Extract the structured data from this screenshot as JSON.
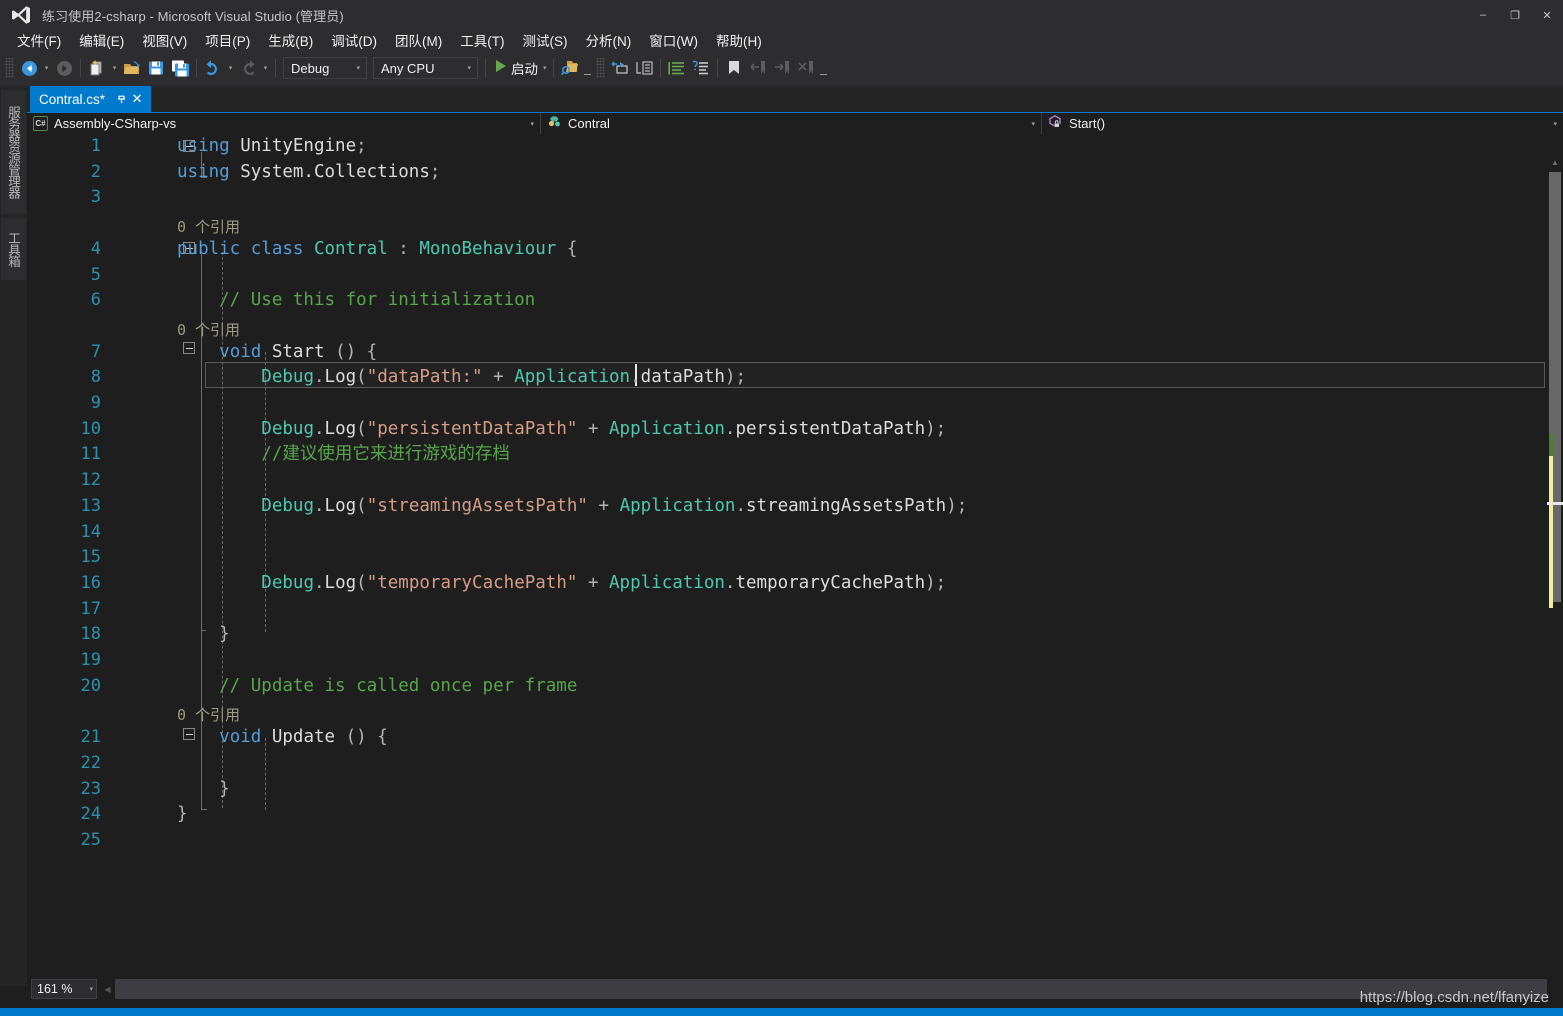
{
  "window": {
    "title": "练习使用2-csharp - Microsoft Visual Studio (管理员)",
    "logo_icon": "visual-studio-logo",
    "minimize_label": "–",
    "maximize_label": "❐",
    "close_label": "✕",
    "accent_color": "#007acc",
    "chrome_color": "#2d2d30"
  },
  "menu": {
    "items": [
      {
        "label": "文件(F)"
      },
      {
        "label": "编辑(E)"
      },
      {
        "label": "视图(V)"
      },
      {
        "label": "项目(P)"
      },
      {
        "label": "生成(B)"
      },
      {
        "label": "调试(D)"
      },
      {
        "label": "团队(M)"
      },
      {
        "label": "工具(T)"
      },
      {
        "label": "测试(S)"
      },
      {
        "label": "分析(N)"
      },
      {
        "label": "窗口(W)"
      },
      {
        "label": "帮助(H)"
      }
    ]
  },
  "toolbar": {
    "navigate_back_icon": "navigate-back-icon",
    "navigate_forward_icon": "navigate-forward-icon",
    "new_item_icon": "new-item-icon",
    "open_file_icon": "open-file-icon",
    "save_icon": "save-icon",
    "save_all_icon": "save-all-icon",
    "undo_icon": "undo-icon",
    "redo_icon": "redo-icon",
    "configuration": {
      "value": "Debug",
      "arrow": "▾"
    },
    "platform": {
      "value": "Any CPU",
      "arrow": "▾"
    },
    "run_label": "启动",
    "run_icon": "play-icon",
    "run_arrow": "▾",
    "find_icon": "find-in-files-icon",
    "step_icon": "step-into-icon",
    "call_stack_icon": "call-hierarchy-icon",
    "comment_icon": "comment-selection-icon",
    "uncomment_icon": "uncomment-selection-icon",
    "indent_icon": "increase-indent-icon",
    "outdent_icon": "decrease-indent-icon",
    "bookmark_icon": "bookmark-icon",
    "prev_bookmark_icon": "previous-bookmark-icon",
    "next_bookmark_icon": "next-bookmark-icon",
    "clear_bookmark_icon": "clear-bookmarks-icon",
    "overflow_icon": "toolbar-overflow-icon"
  },
  "left_rail": {
    "tabs": [
      {
        "label": "服务器资源管理器",
        "name": "server-explorer"
      },
      {
        "label": "工具箱",
        "name": "toolbox"
      }
    ]
  },
  "document_tab": {
    "label": "Contral.cs*",
    "pin_icon": "pin-icon",
    "close_icon": "close-icon"
  },
  "navbar": {
    "project": {
      "label": "Assembly-CSharp-vs",
      "icon": "csharp-project-icon",
      "arrow": "▾"
    },
    "type": {
      "label": "Contral",
      "icon": "class-icon",
      "arrow": "▾"
    },
    "member": {
      "label": "Start()",
      "icon": "method-private-icon",
      "arrow": "▾"
    }
  },
  "editor": {
    "zoom": "161 %",
    "zoom_arrow": "▾",
    "lines": [
      {
        "num": "1",
        "tokens": [
          {
            "t": "using ",
            "c": "kw"
          },
          {
            "t": "UnityEngine",
            "c": "pln"
          },
          {
            "t": ";",
            "c": "opr"
          }
        ]
      },
      {
        "num": "2",
        "tokens": [
          {
            "t": "using ",
            "c": "kw"
          },
          {
            "t": "System.Collections",
            "c": "pln"
          },
          {
            "t": ";",
            "c": "opr"
          }
        ]
      },
      {
        "num": "3",
        "tokens": []
      },
      {
        "num": "4",
        "tokens": [
          {
            "t": "public ",
            "c": "kw"
          },
          {
            "t": "class ",
            "c": "kw"
          },
          {
            "t": "Contral",
            "c": "typ"
          },
          {
            "t": " : ",
            "c": "opr"
          },
          {
            "t": "MonoBehaviour",
            "c": "typ"
          },
          {
            "t": " {",
            "c": "opr"
          }
        ]
      },
      {
        "num": "5",
        "tokens": []
      },
      {
        "num": "6",
        "tokens": [
          {
            "t": "    // Use this for initialization",
            "c": "cmt"
          }
        ]
      },
      {
        "num": "7",
        "tokens": [
          {
            "t": "    ",
            "c": "pln"
          },
          {
            "t": "void ",
            "c": "kw"
          },
          {
            "t": "Start",
            "c": "pln"
          },
          {
            "t": " () {",
            "c": "opr"
          }
        ]
      },
      {
        "num": "8",
        "tokens": [
          {
            "t": "        ",
            "c": "pln"
          },
          {
            "t": "Debug",
            "c": "typ"
          },
          {
            "t": ".",
            "c": "opr"
          },
          {
            "t": "Log",
            "c": "pln"
          },
          {
            "t": "(",
            "c": "opr"
          },
          {
            "t": "\"dataPath:\"",
            "c": "str"
          },
          {
            "t": " + ",
            "c": "opr"
          },
          {
            "t": "Application",
            "c": "typ"
          },
          {
            "t": ".",
            "c": "opr"
          },
          {
            "t": "dataPath",
            "c": "pln"
          },
          {
            "t": ");",
            "c": "opr"
          }
        ]
      },
      {
        "num": "9",
        "tokens": []
      },
      {
        "num": "10",
        "tokens": [
          {
            "t": "        ",
            "c": "pln"
          },
          {
            "t": "Debug",
            "c": "typ"
          },
          {
            "t": ".",
            "c": "opr"
          },
          {
            "t": "Log",
            "c": "pln"
          },
          {
            "t": "(",
            "c": "opr"
          },
          {
            "t": "\"persistentDataPath\"",
            "c": "str"
          },
          {
            "t": " + ",
            "c": "opr"
          },
          {
            "t": "Application",
            "c": "typ"
          },
          {
            "t": ".",
            "c": "opr"
          },
          {
            "t": "persistentDataPath",
            "c": "pln"
          },
          {
            "t": ");",
            "c": "opr"
          }
        ]
      },
      {
        "num": "11",
        "tokens": [
          {
            "t": "        //建议使用它来进行游戏的存档",
            "c": "cmt"
          }
        ]
      },
      {
        "num": "12",
        "tokens": []
      },
      {
        "num": "13",
        "tokens": [
          {
            "t": "        ",
            "c": "pln"
          },
          {
            "t": "Debug",
            "c": "typ"
          },
          {
            "t": ".",
            "c": "opr"
          },
          {
            "t": "Log",
            "c": "pln"
          },
          {
            "t": "(",
            "c": "opr"
          },
          {
            "t": "\"streamingAssetsPath\"",
            "c": "str"
          },
          {
            "t": " + ",
            "c": "opr"
          },
          {
            "t": "Application",
            "c": "typ"
          },
          {
            "t": ".",
            "c": "opr"
          },
          {
            "t": "streamingAssetsPath",
            "c": "pln"
          },
          {
            "t": ");",
            "c": "opr"
          }
        ]
      },
      {
        "num": "14",
        "tokens": []
      },
      {
        "num": "15",
        "tokens": []
      },
      {
        "num": "16",
        "tokens": [
          {
            "t": "        ",
            "c": "pln"
          },
          {
            "t": "Debug",
            "c": "typ"
          },
          {
            "t": ".",
            "c": "opr"
          },
          {
            "t": "Log",
            "c": "pln"
          },
          {
            "t": "(",
            "c": "opr"
          },
          {
            "t": "\"temporaryCachePath\"",
            "c": "str"
          },
          {
            "t": " + ",
            "c": "opr"
          },
          {
            "t": "Application",
            "c": "typ"
          },
          {
            "t": ".",
            "c": "opr"
          },
          {
            "t": "temporaryCachePath",
            "c": "pln"
          },
          {
            "t": ");",
            "c": "opr"
          }
        ]
      },
      {
        "num": "17",
        "tokens": []
      },
      {
        "num": "18",
        "tokens": [
          {
            "t": "    }",
            "c": "opr"
          }
        ]
      },
      {
        "num": "19",
        "tokens": []
      },
      {
        "num": "20",
        "tokens": [
          {
            "t": "    // Update is called once per frame",
            "c": "cmt"
          }
        ]
      },
      {
        "num": "21",
        "tokens": [
          {
            "t": "    ",
            "c": "pln"
          },
          {
            "t": "void ",
            "c": "kw"
          },
          {
            "t": "Update",
            "c": "pln"
          },
          {
            "t": " () {",
            "c": "opr"
          }
        ]
      },
      {
        "num": "22",
        "tokens": []
      },
      {
        "num": "23",
        "tokens": [
          {
            "t": "    }",
            "c": "opr"
          }
        ]
      },
      {
        "num": "24",
        "tokens": [
          {
            "t": "}",
            "c": "opr"
          }
        ]
      },
      {
        "num": "25",
        "tokens": []
      }
    ],
    "codelens": [
      {
        "label": "0 个引用",
        "above_line": "4"
      },
      {
        "label": "0 个引用",
        "above_line": "7"
      },
      {
        "label": "0 个引用",
        "above_line": "21"
      }
    ],
    "caret_line": "8",
    "change_bar": {
      "saved_color": "#4f7c2f",
      "unsaved_color": "#eeee9e"
    }
  },
  "status": {
    "watermark": "https://blog.csdn.net/lfanyize"
  }
}
